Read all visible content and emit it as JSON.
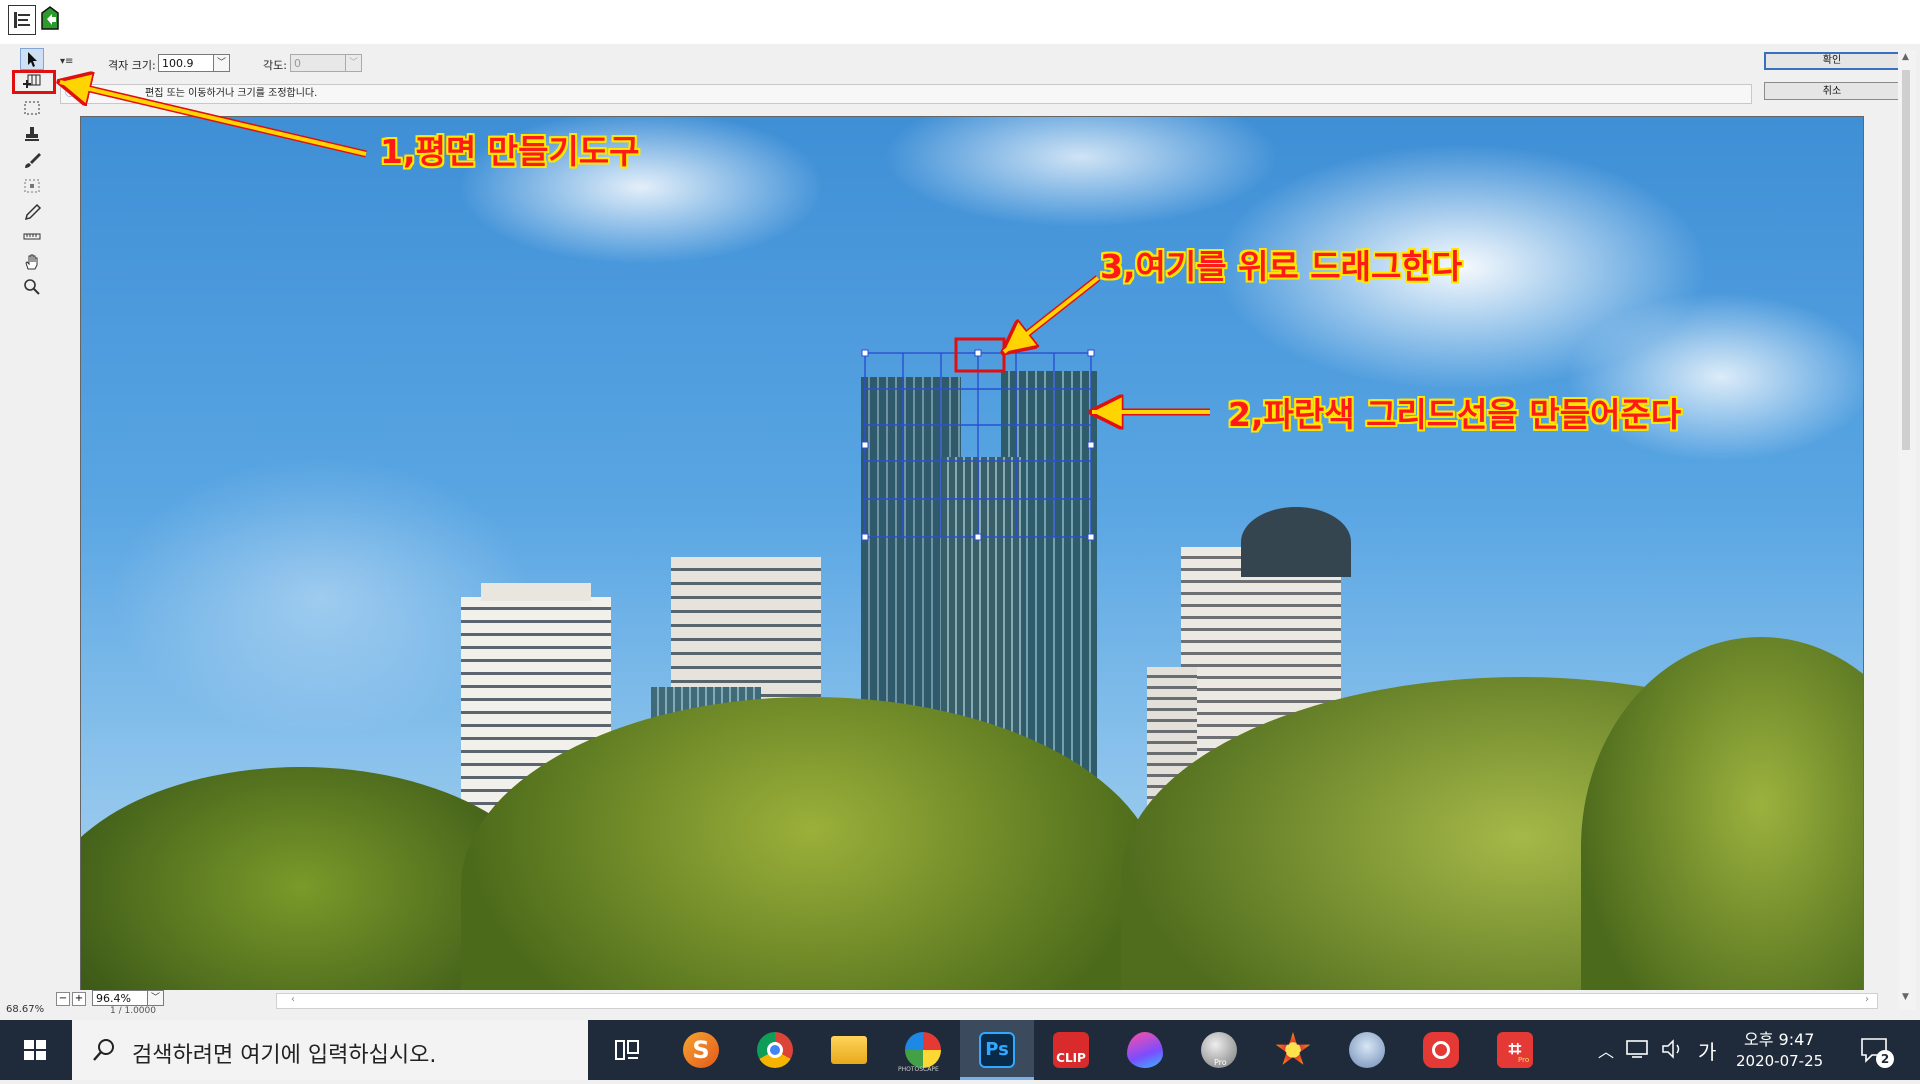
{
  "options": {
    "grid_size_label": "격자 크기:",
    "grid_size_value": "100.9",
    "angle_label": "각도:",
    "angle_value": "0"
  },
  "hint": {
    "text": "편집 또는 이동하거나 크기를 조정합니다."
  },
  "buttons": {
    "ok": "확인",
    "cancel": "취소"
  },
  "zoom": {
    "level": "96.4%",
    "left_partial": "68.67%",
    "doc_info_partial": "1 / 1.0000"
  },
  "annotations": {
    "note1": "1,평면 만들기도구",
    "note2": "2,파란색 그리드선을 만들어준다",
    "note3": "3,여기를 위로 드래그한다",
    "color_text": "#ff1a1a",
    "color_outline": "#ffe800",
    "color_arrow": "#ffd400"
  },
  "taskbar": {
    "search_placeholder": "검색하려면 여기에 입력하십시오.",
    "apps": [
      {
        "name": "task-view",
        "label": ""
      },
      {
        "name": "app-s",
        "label": ""
      },
      {
        "name": "chrome",
        "label": ""
      },
      {
        "name": "file-explorer",
        "label": ""
      },
      {
        "name": "photoscape",
        "label": "PHOTOSCAPE"
      },
      {
        "name": "photoshop",
        "label": "Ps"
      },
      {
        "name": "clip",
        "label": "CLIP"
      },
      {
        "name": "color-drop",
        "label": ""
      },
      {
        "name": "app-pro",
        "label": "Pro"
      },
      {
        "name": "app-star",
        "label": ""
      },
      {
        "name": "app-bird",
        "label": ""
      },
      {
        "name": "app-camera",
        "label": ""
      },
      {
        "name": "app-crop",
        "label": "Pro"
      }
    ],
    "ime": "가",
    "time": "오후 9:47",
    "date": "2020-07-25",
    "notifications": "2"
  },
  "colors": {
    "grid": "#2a4fd0",
    "selection_box": "#e01010",
    "taskbar_bg": "#1f2b3a"
  }
}
